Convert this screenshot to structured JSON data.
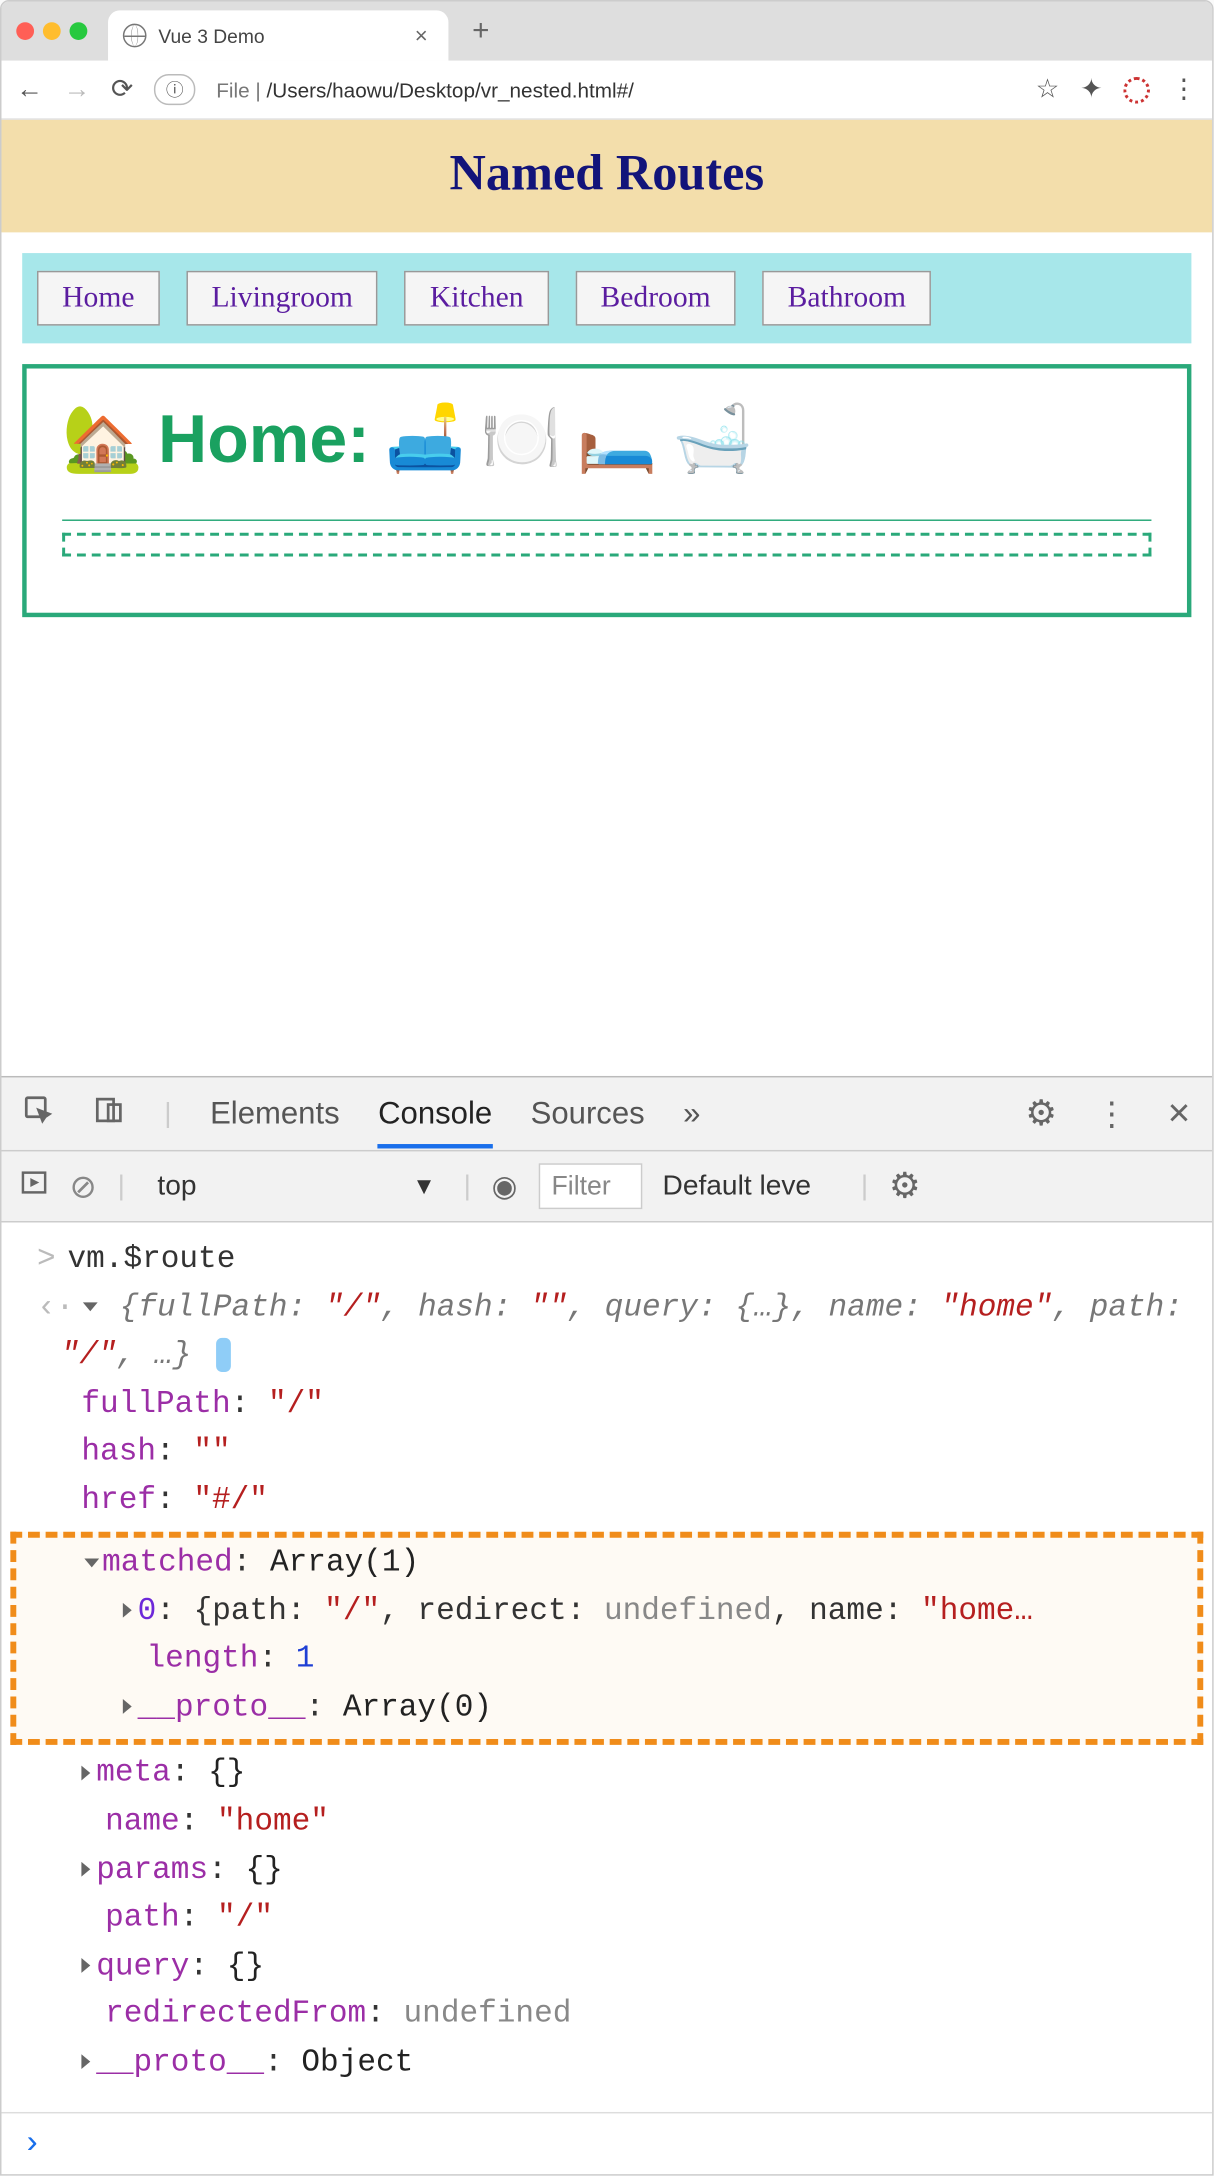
{
  "browser": {
    "tabTitle": "Vue 3 Demo",
    "closeGlyph": "×",
    "plusGlyph": "+",
    "addressPrefix": "File  | ",
    "addressPath": "/Users/haowu/Desktop/vr_nested.html#/",
    "fileBadge": "ⓘ",
    "starGlyph": "☆",
    "puzzleGlyph": "✦",
    "menuGlyph": "⋮"
  },
  "page": {
    "title": "Named Routes",
    "nav": [
      "Home",
      "Livingroom",
      "Kitchen",
      "Bedroom",
      "Bathroom"
    ],
    "homeLabel": "Home:",
    "homeIcons": [
      "🏡",
      "🛋️",
      "🍽️",
      "🛏️",
      "🛁"
    ]
  },
  "devtools": {
    "tabs": {
      "elements": "Elements",
      "console": "Console",
      "sources": "Sources",
      "more": "»"
    },
    "gear": "⚙",
    "dots": "⋮",
    "close": "✕",
    "context": "top",
    "filterPlaceholder": "Filter",
    "level": "Default leve",
    "prompt": ">",
    "input": "vm.$route",
    "outback": "‹·",
    "preview": "{fullPath: \"/\", hash: \"\", query: {…}, name: \"home\", path: \"/\", …}",
    "props": {
      "fullPath": {
        "k": "fullPath",
        "v": "\"/\""
      },
      "hash": {
        "k": "hash",
        "v": "\"\""
      },
      "href": {
        "k": "href",
        "v": "\"#/\""
      },
      "matched": {
        "k": "matched",
        "v": "Array(1)"
      },
      "matched0": "0: {path: \"/\", redirect: undefined, name: \"home…",
      "matchedLen": {
        "k": "length",
        "v": "1"
      },
      "matchedProto": {
        "k": "__proto__",
        "v": "Array(0)"
      },
      "meta": {
        "k": "meta",
        "v": "{}"
      },
      "name": {
        "k": "name",
        "v": "\"home\""
      },
      "params": {
        "k": "params",
        "v": "{}"
      },
      "path": {
        "k": "path",
        "v": "\"/\""
      },
      "query": {
        "k": "query",
        "v": "{}"
      },
      "redirectedFrom": {
        "k": "redirectedFrom",
        "v": "undefined"
      },
      "proto": {
        "k": "__proto__",
        "v": "Object"
      }
    }
  }
}
